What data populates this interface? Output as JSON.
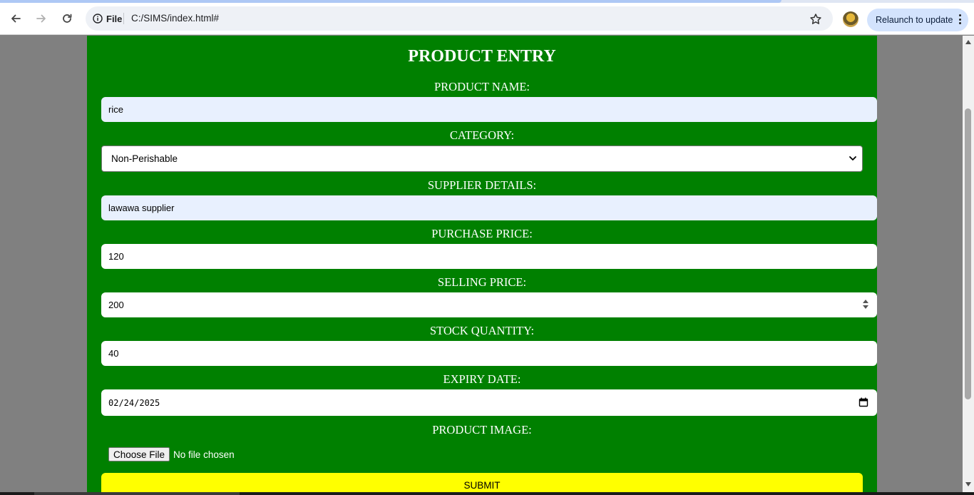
{
  "browser": {
    "chip_label": "File",
    "url": "C:/SIMS/index.html#",
    "relaunch_label": "Relaunch to update"
  },
  "form": {
    "title": "PRODUCT ENTRY",
    "product_name": {
      "label": "PRODUCT NAME:",
      "value": "rice"
    },
    "category": {
      "label": "CATEGORY:",
      "value": "Non-Perishable"
    },
    "supplier": {
      "label": "SUPPLIER DETAILS:",
      "value": "lawawa supplier"
    },
    "purchase_price": {
      "label": "PURCHASE PRICE:",
      "value": "120"
    },
    "selling_price": {
      "label": "SELLING PRICE:",
      "value": "200"
    },
    "stock_quantity": {
      "label": "STOCK QUANTITY:",
      "value": "40"
    },
    "expiry_date": {
      "label": "EXPIRY DATE:",
      "value": "02/24/2025"
    },
    "product_image": {
      "label": "PRODUCT IMAGE:",
      "button": "Choose File",
      "status": "No file chosen"
    },
    "submit_label": "SUBMIT"
  },
  "colors": {
    "panel": "#008000",
    "submit": "#ffff00",
    "autofill": "#e8f0fe",
    "page_bg": "#808080"
  }
}
